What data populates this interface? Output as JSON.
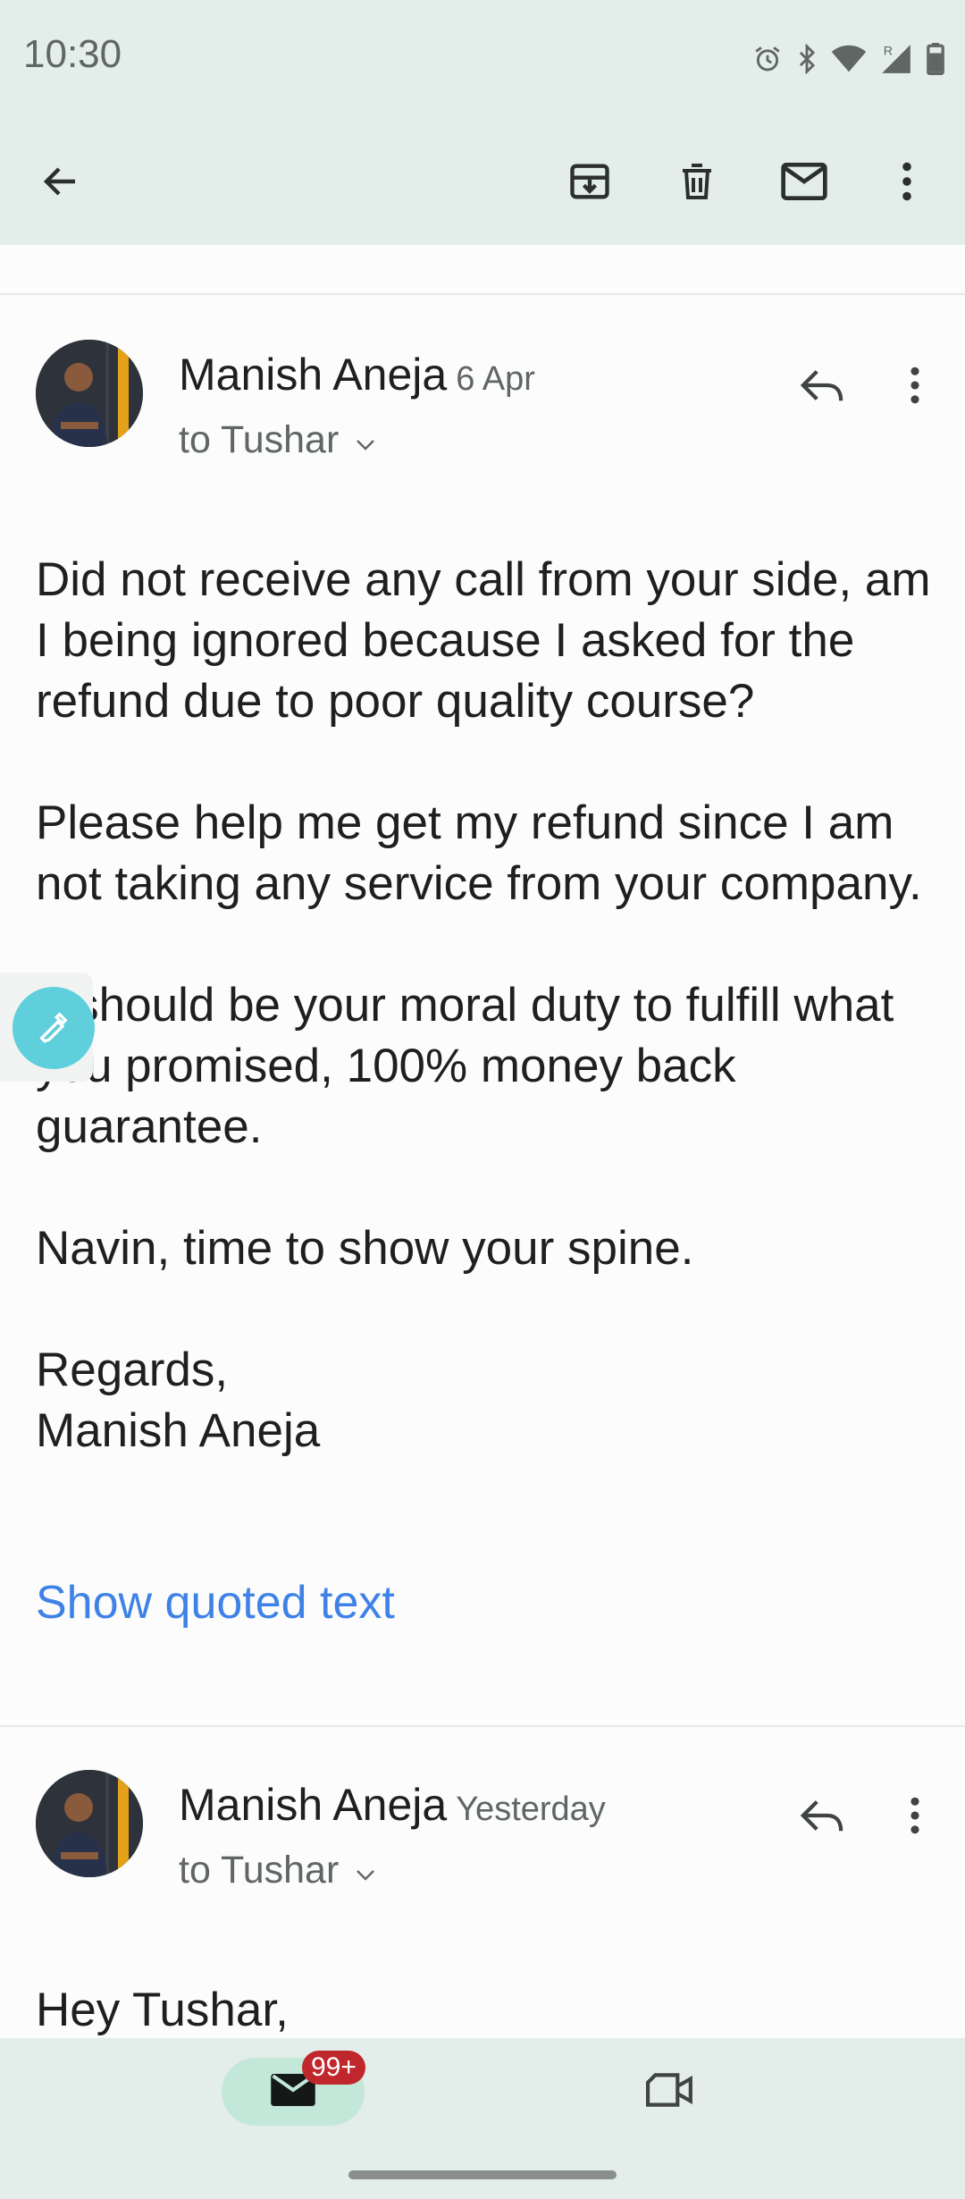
{
  "status_bar": {
    "time": "10:30",
    "icons": [
      "alarm-icon",
      "bluetooth-icon",
      "wifi-icon",
      "signal-roaming-icon",
      "battery-icon"
    ]
  },
  "top_bar": {
    "actions": [
      "back-arrow-icon",
      "archive-icon",
      "delete-icon",
      "mark-unread-icon",
      "more-vert-icon"
    ]
  },
  "messages": [
    {
      "sender": "Manish Aneja",
      "date": "6 Apr",
      "to": "to Tushar",
      "body": [
        "Did not receive any call from your side, am I being ignored because I asked for the refund due to poor quality course?",
        "Please help me get my refund since I am not taking any service from your company.",
        "It should be your moral duty to fulfill what you promised, 100% money back guarantee.",
        "Navin, time to show your spine.",
        "Regards,",
        "Manish Aneja"
      ],
      "quoted_link": "Show quoted text"
    },
    {
      "sender": "Manish Aneja",
      "date": "Yesterday",
      "to": "to Tushar",
      "body": [
        "Hey Tushar,"
      ]
    }
  ],
  "bottom_nav": {
    "mail_badge": "99+",
    "items": [
      "mail-icon",
      "meet-video-icon"
    ]
  },
  "colors": {
    "header_bg": "#e3ede9",
    "link": "#3f82e7",
    "badge": "#c0272d",
    "active_pill": "#c3e8da",
    "fab": "#5fcfdc"
  }
}
